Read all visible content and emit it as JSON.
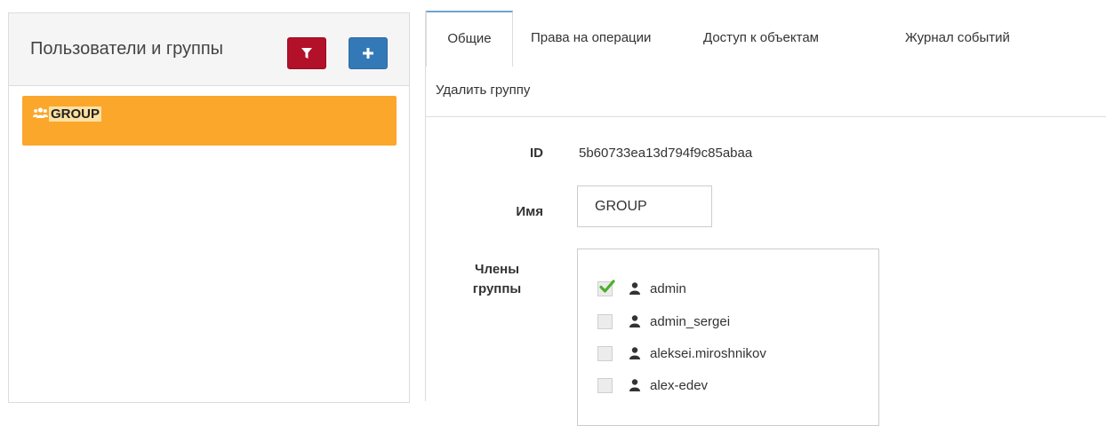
{
  "sidebar": {
    "title": "Пользователи и группы",
    "filter_icon": "filter-icon",
    "add_icon": "plus-icon",
    "groups": [
      {
        "label": "GROUP",
        "icon": "users-icon",
        "selected": true
      }
    ],
    "colors": {
      "filter_button": "#b3102a",
      "add_button": "#3479b7",
      "selected_item": "#fba72b"
    }
  },
  "tabs": [
    {
      "label": "Общие",
      "active": true
    },
    {
      "label": "Права на операции",
      "active": false
    },
    {
      "label": "Доступ к объектам",
      "active": false
    },
    {
      "label": "Журнал событий",
      "active": false
    },
    {
      "label": "Удалить группу",
      "active": false
    }
  ],
  "form": {
    "id_label": "ID",
    "id_value": "5b60733ea13d794f9c85abaa",
    "name_label": "Имя",
    "name_value": "GROUP",
    "members_label": "Члены группы",
    "members": [
      {
        "name": "admin",
        "checked": true
      },
      {
        "name": "admin_sergei",
        "checked": false
      },
      {
        "name": "aleksei.miroshnikov",
        "checked": false
      },
      {
        "name": "alex-edev",
        "checked": false
      }
    ]
  }
}
